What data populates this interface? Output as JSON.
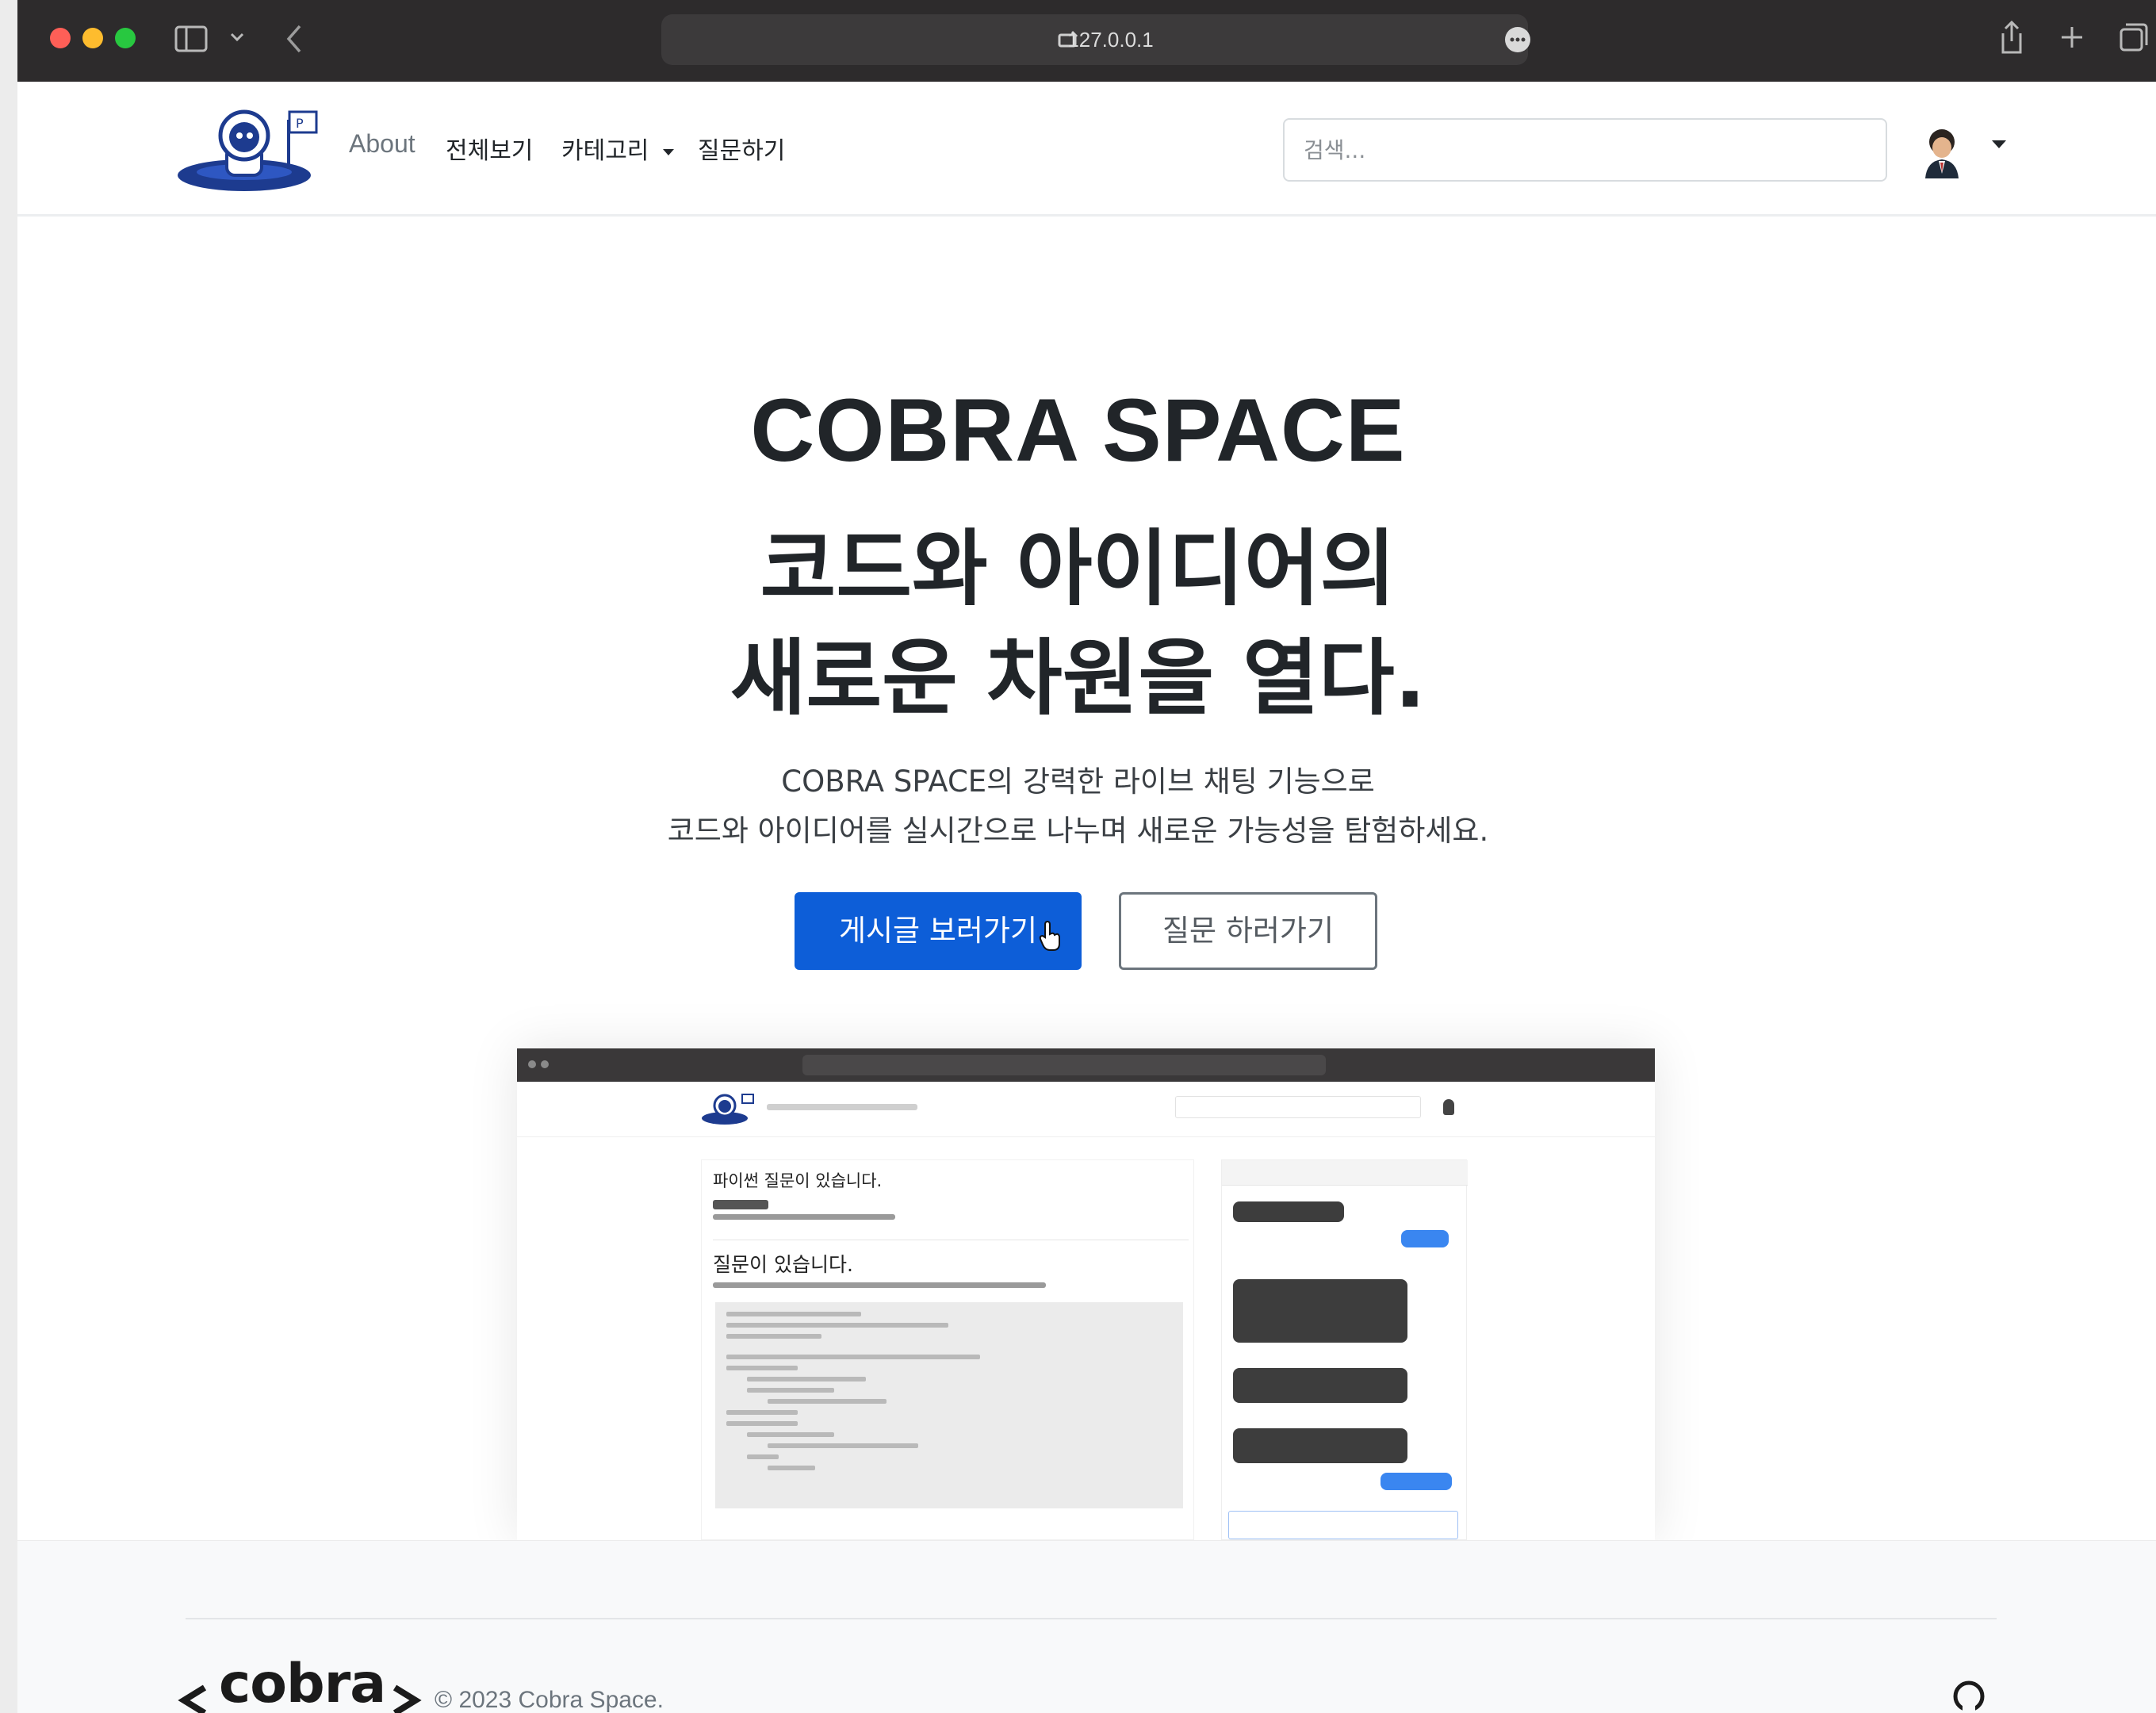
{
  "browser": {
    "url": "127.0.0.1"
  },
  "nav": {
    "links": [
      "About",
      "전체보기",
      "카테고리",
      "질문하기"
    ],
    "search_placeholder": "검색..."
  },
  "hero": {
    "title_line1": "COBRA SPACE",
    "title_line2": "코드와 아이디어의",
    "title_line3": "새로운 차원을 열다.",
    "subtitle_line1": "COBRA SPACE의 강력한 라이브 채팅 기능으로",
    "subtitle_line2": "코드와 아이디어를 실시간으로 나누며 새로운 가능성을 탐험하세요.",
    "primary_button": "게시글 보러가기",
    "secondary_button": "질문 하러가기"
  },
  "preview": {
    "post_title": "파이썬 질문이 있습니다.",
    "post_heading": "질문이 있습니다."
  },
  "footer": {
    "brand": "cobra",
    "copyright": "© 2023 Cobra Space."
  },
  "colors": {
    "primary": "#0d5ed8",
    "chrome": "#2d2b2c",
    "text": "#212529"
  },
  "icons": [
    "sidebar-icon",
    "chevron-down-icon",
    "back-icon",
    "site-icon",
    "more-icon",
    "share-icon",
    "plus-icon",
    "tabs-icon",
    "avatar",
    "caret-down-icon",
    "github-icon",
    "cursor-icon"
  ]
}
